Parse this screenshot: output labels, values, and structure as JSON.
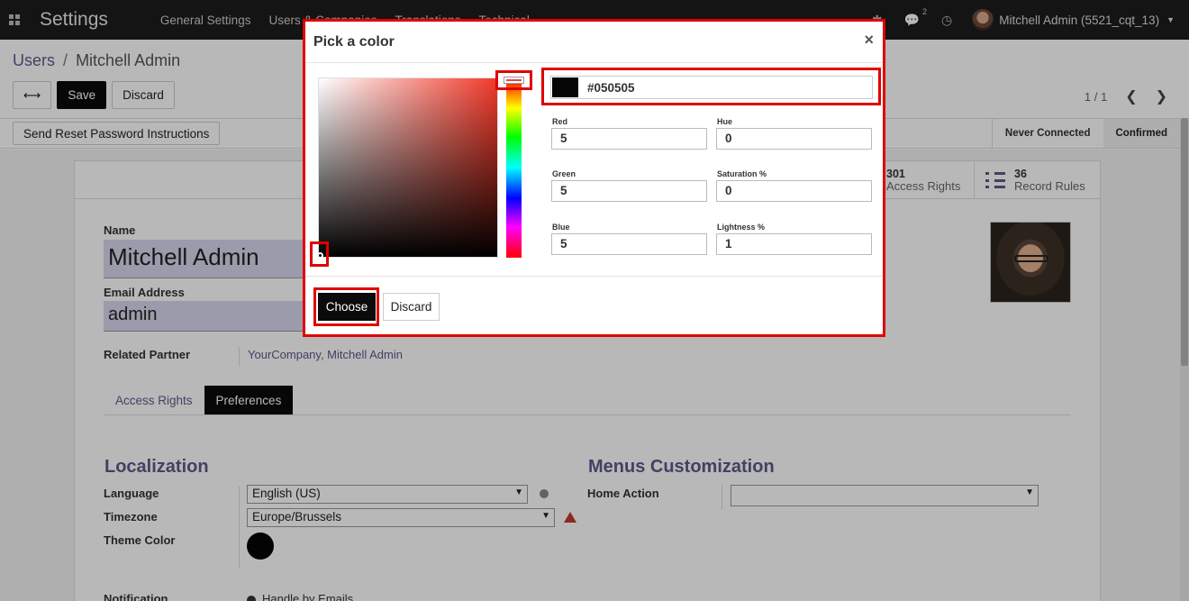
{
  "navbar": {
    "brand": "Settings",
    "menu": [
      "General Settings",
      "Users & Companies",
      "Translations",
      "Technical"
    ],
    "messages_badge": "2",
    "user_name": "Mitchell Admin (5521_cqt_13)"
  },
  "breadcrumb": {
    "parent": "Users",
    "separator": "/",
    "current": "Mitchell Admin"
  },
  "toolbar": {
    "save_label": "Save",
    "discard_label": "Discard",
    "expand_icon": "arrows-h-icon"
  },
  "pager": {
    "text": "1 / 1"
  },
  "status": {
    "reset_button": "Send Reset Password Instructions",
    "steps": [
      "Never Connected",
      "Confirmed"
    ]
  },
  "stats": [
    {
      "num": "301",
      "label": "Access Rights"
    },
    {
      "num": "36",
      "label": "Record Rules"
    }
  ],
  "form": {
    "name_label": "Name",
    "name_value": "Mitchell Admin",
    "email_label": "Email Address",
    "email_value": "admin",
    "partner_label": "Related Partner",
    "partner_value": "YourCompany, Mitchell Admin"
  },
  "tabs": [
    "Access Rights",
    "Preferences"
  ],
  "preferences": {
    "localization_title": "Localization",
    "language_label": "Language",
    "language_value": "English (US)",
    "timezone_label": "Timezone",
    "timezone_value": "Europe/Brussels",
    "theme_label": "Theme Color",
    "theme_color": "#050505",
    "notification_label": "Notification",
    "notification_value": "Handle by Emails",
    "menus_title": "Menus Customization",
    "home_action_label": "Home Action",
    "home_action_value": ""
  },
  "modal": {
    "title": "Pick a color",
    "close": "×",
    "hex": "#050505",
    "red_label": "Red",
    "red": "5",
    "green_label": "Green",
    "green": "5",
    "blue_label": "Blue",
    "blue": "5",
    "hue_label": "Hue",
    "hue": "0",
    "saturation_label": "Saturation %",
    "saturation": "0",
    "lightness_label": "Lightness %",
    "lightness": "1",
    "choose_label": "Choose",
    "discard_label": "Discard"
  },
  "colors": {
    "accent": "#5a5a8a",
    "highlight": "#e00000",
    "navbar": "#1c1c1c"
  }
}
